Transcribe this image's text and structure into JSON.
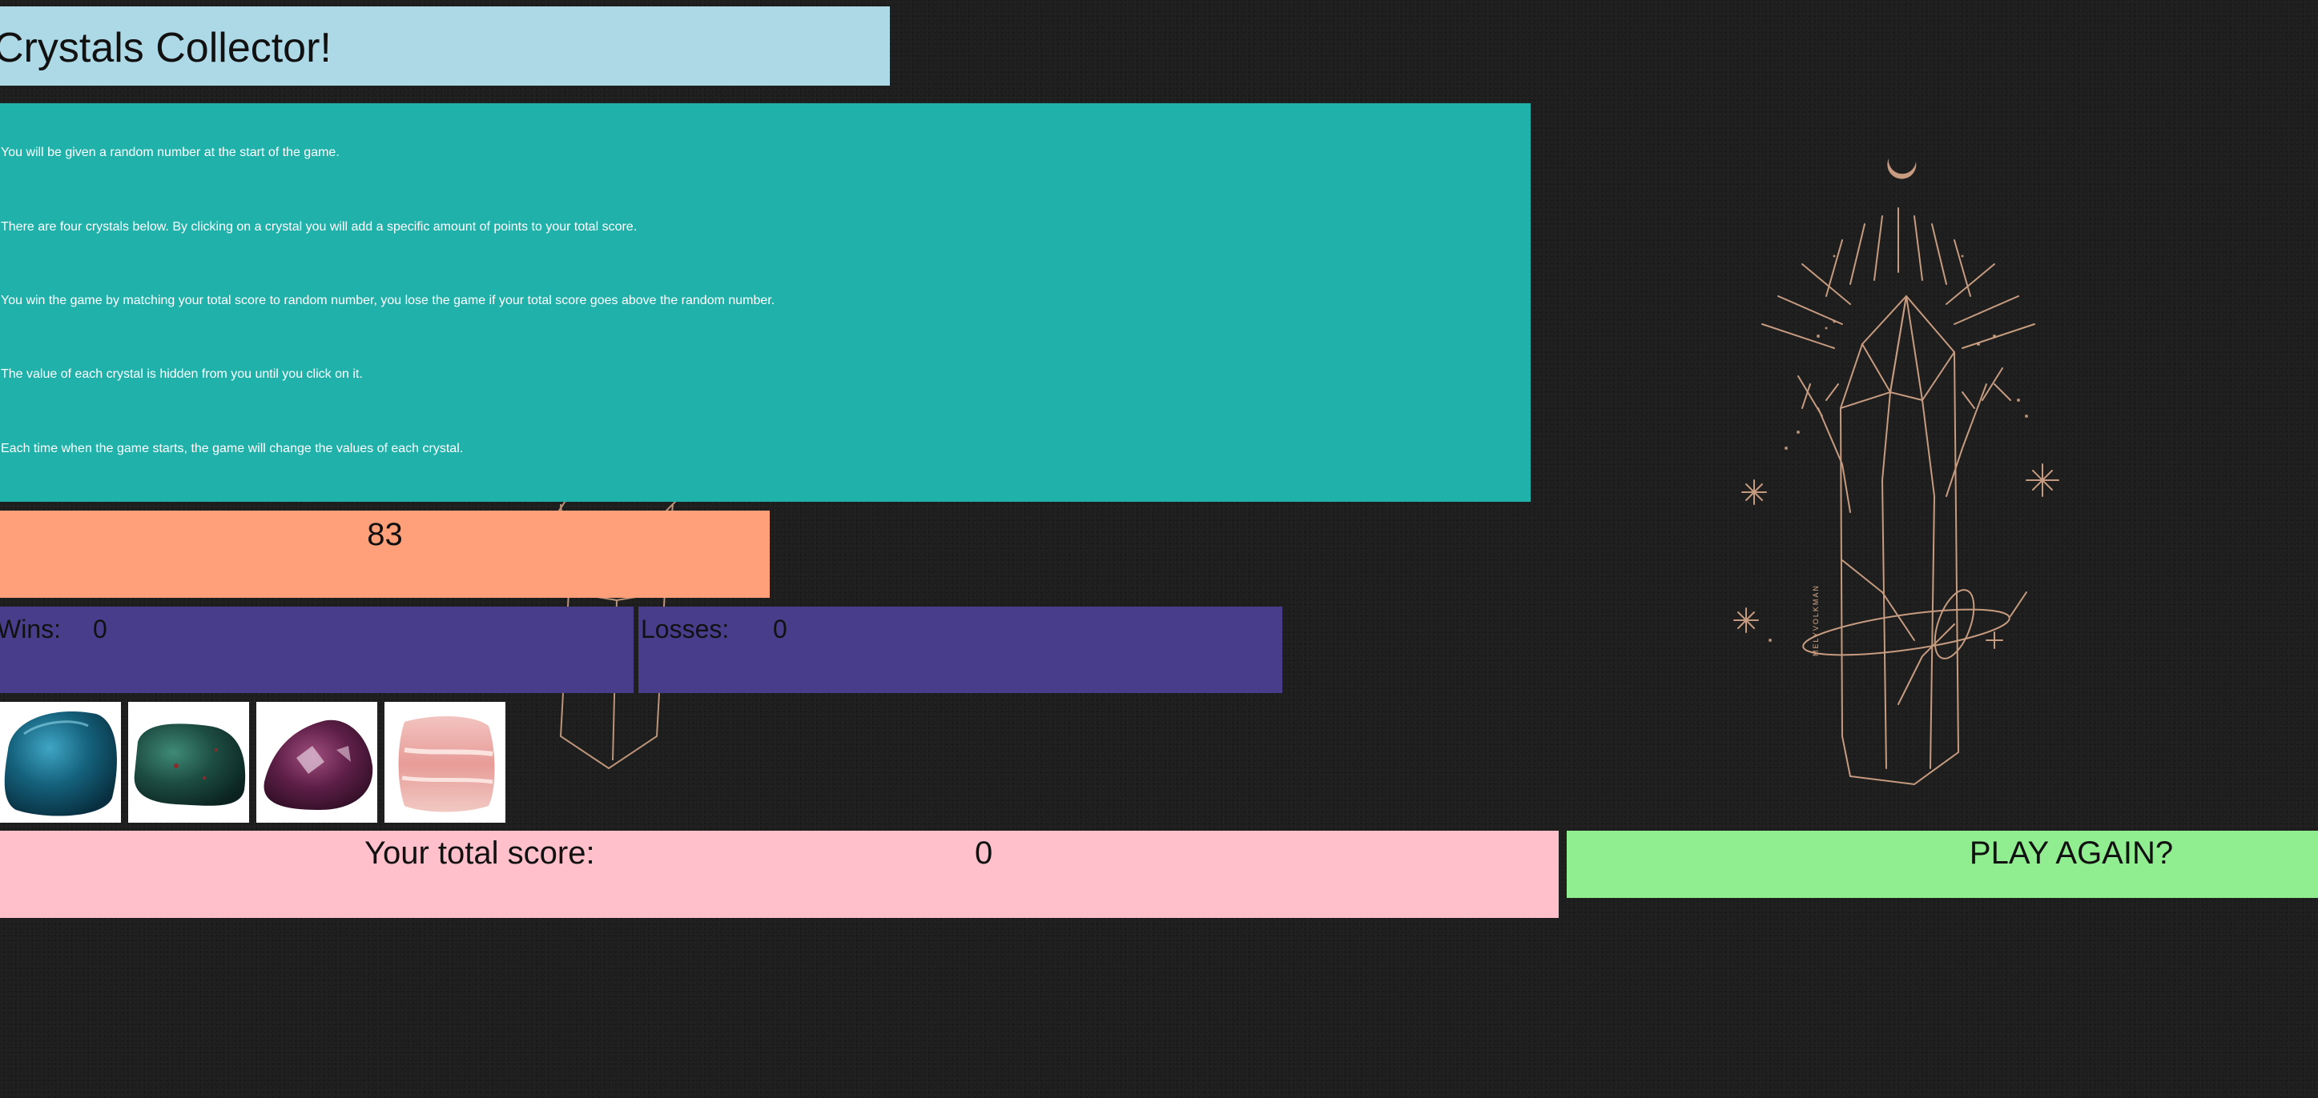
{
  "header": {
    "title": "Crystals Collector!"
  },
  "instructions": [
    "You will be given a random number at the start of the game.",
    "There are four crystals below. By clicking on a crystal you will add a specific amount of points to your total score.",
    "You win the game by matching your total score to random number, you lose the game if your total score goes above the random number.",
    "The value of each crystal is hidden from you until you click on it.",
    "Each time when the game starts, the game will change the values of each crystal."
  ],
  "target": {
    "random_number": "83"
  },
  "stats": {
    "wins_label": "Wins:",
    "wins_value": "0",
    "losses_label": "Losses:",
    "losses_value": "0"
  },
  "crystals": [
    {
      "icon": "blue-crystal-icon",
      "color": "#1b6f8c"
    },
    {
      "icon": "green-crystal-icon",
      "color": "#1f5a4c"
    },
    {
      "icon": "purple-crystal-icon",
      "color": "#6a2a52"
    },
    {
      "icon": "pink-crystal-icon",
      "color": "#e9a7a3"
    }
  ],
  "score": {
    "label": "Your total score:",
    "value": "0"
  },
  "play_again": {
    "label": "PLAY AGAIN?"
  },
  "background": {
    "artwork_signature": "MELYVOLKMAN"
  },
  "colors": {
    "title_bg": "#add8e6",
    "instructions_bg": "#20b2aa",
    "target_bg": "#ffa07a",
    "stats_bg": "#483d8b",
    "score_bg": "#ffc0cb",
    "play_again_bg": "#90ee90",
    "page_bg": "#1e1e1e",
    "art_line": "#d9a98a"
  }
}
